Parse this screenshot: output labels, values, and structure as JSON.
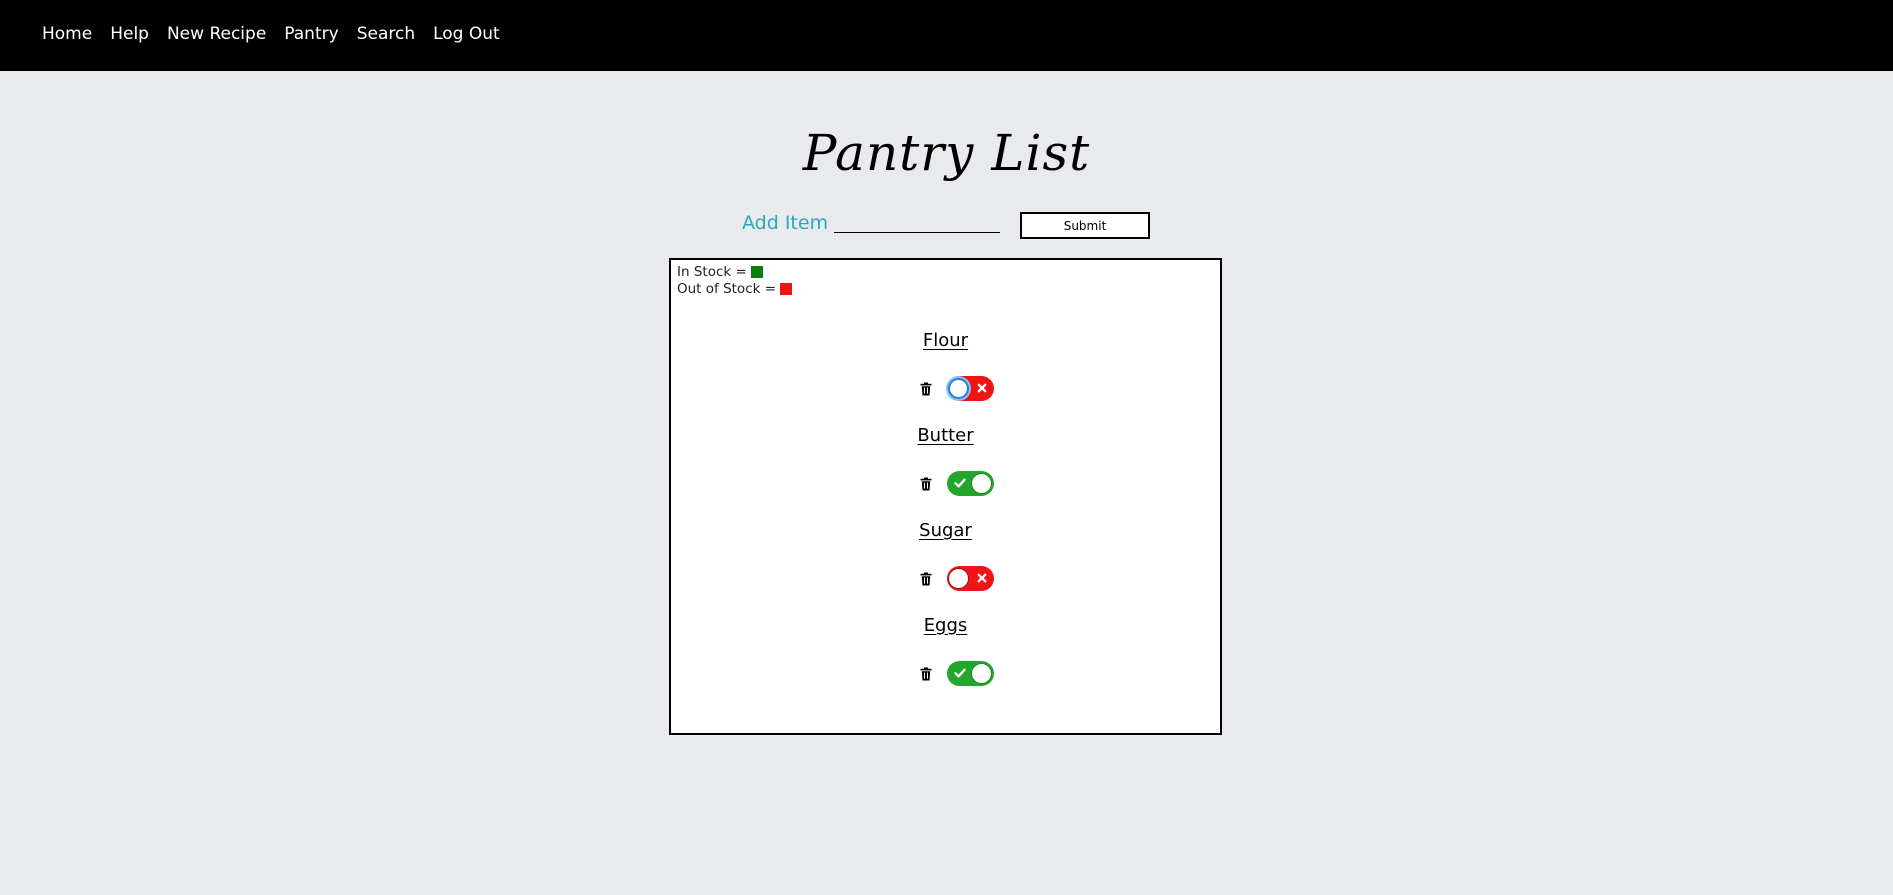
{
  "nav": {
    "items": [
      {
        "label": "Home"
      },
      {
        "label": "Help"
      },
      {
        "label": "New Recipe"
      },
      {
        "label": "Pantry"
      },
      {
        "label": "Search"
      },
      {
        "label": "Log Out"
      }
    ]
  },
  "page": {
    "title": "Pantry List"
  },
  "add_item": {
    "label": "Add Item",
    "value": "",
    "placeholder": "",
    "submit_label": "Submit"
  },
  "legend": {
    "in_stock_label": "In Stock =",
    "in_stock_color": "#0a7d0a",
    "out_of_stock_label": "Out of Stock =",
    "out_of_stock_color": "#f21414"
  },
  "colors": {
    "accent": "#2aa8bf",
    "toggle_on": "#22a62c",
    "toggle_off": "#f21414",
    "navbar": "#000000",
    "background": "#e8eaee"
  },
  "items": [
    {
      "name": "Flour",
      "in_stock": false,
      "focused": true,
      "delete_icon": "trash-icon"
    },
    {
      "name": "Butter",
      "in_stock": true,
      "focused": false,
      "delete_icon": "trash-icon"
    },
    {
      "name": "Sugar",
      "in_stock": false,
      "focused": false,
      "delete_icon": "trash-icon"
    },
    {
      "name": "Eggs",
      "in_stock": true,
      "focused": false,
      "delete_icon": "trash-icon"
    }
  ]
}
